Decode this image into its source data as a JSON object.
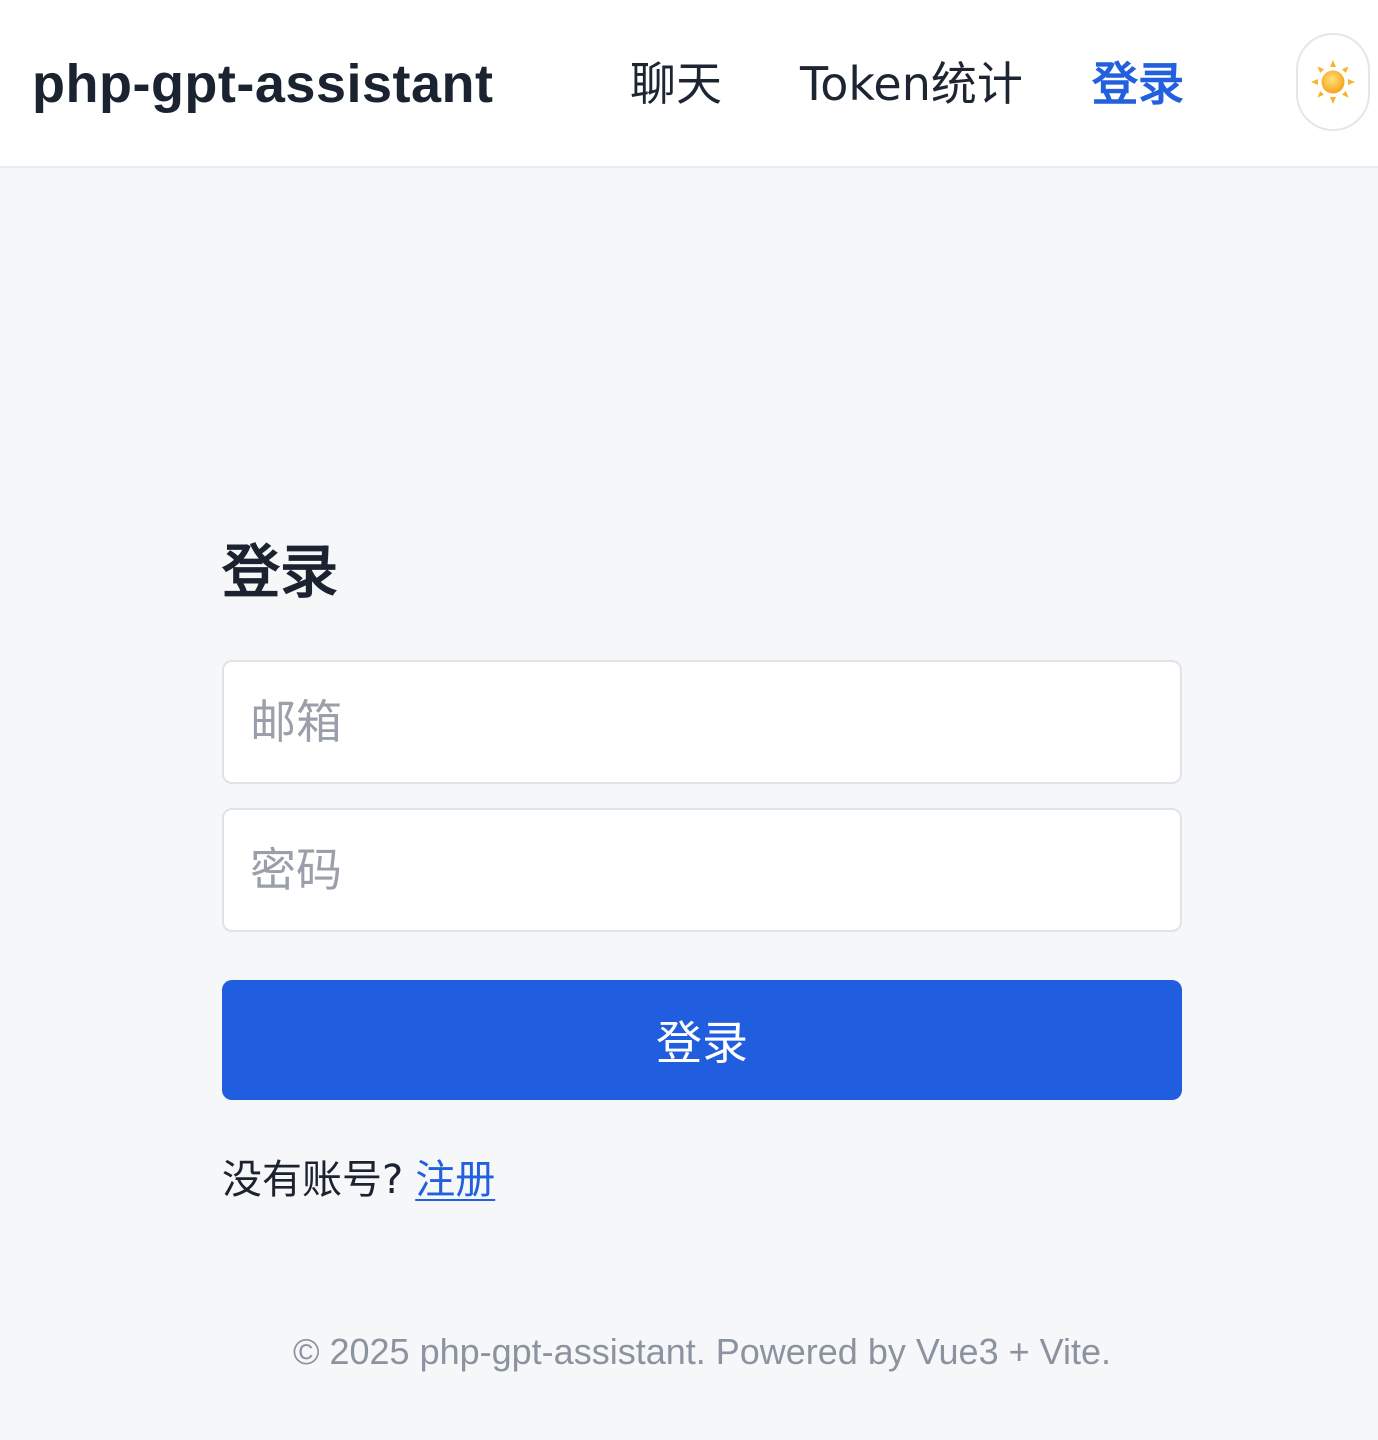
{
  "app": {
    "brand": "php-gpt-assistant"
  },
  "nav": {
    "items": [
      {
        "label": "聊天"
      },
      {
        "label": "Token统计"
      },
      {
        "label": "登录",
        "active": true
      }
    ],
    "theme_toggle_icon": "sun-icon"
  },
  "login": {
    "title": "登录",
    "email": {
      "placeholder": "邮箱",
      "value": ""
    },
    "password": {
      "placeholder": "密码",
      "value": ""
    },
    "submit_label": "登录",
    "register_prompt": "没有账号?",
    "register_link": "注册"
  },
  "footer": {
    "text": "© 2025 php-gpt-assistant. Powered by Vue3 + Vite."
  },
  "colors": {
    "accent": "#215ddf",
    "background": "#f6f7f9",
    "header_bg": "#ffffff",
    "text": "#1b2330",
    "muted": "#8b93a0"
  }
}
